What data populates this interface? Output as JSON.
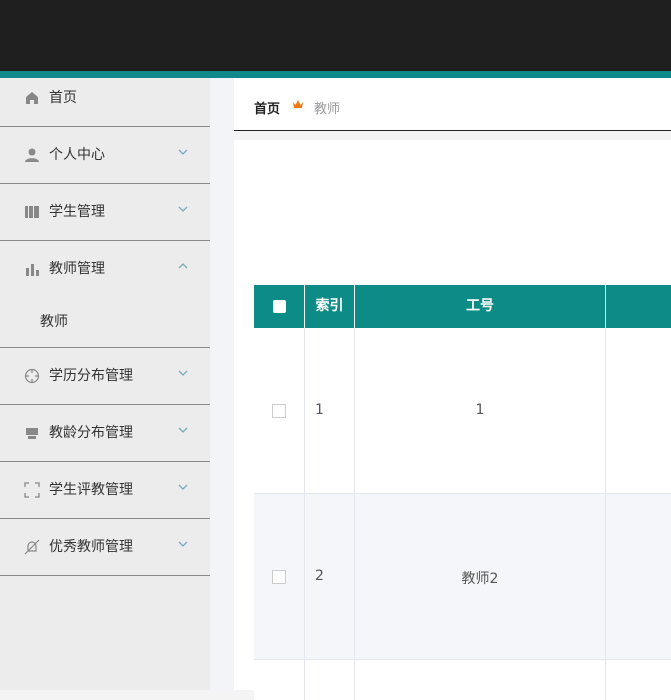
{
  "sidebar": {
    "items": [
      {
        "label": "首页",
        "icon": "home-icon"
      },
      {
        "label": "个人中心",
        "icon": "user-icon"
      },
      {
        "label": "学生管理",
        "icon": "book-icon"
      },
      {
        "label": "教师管理",
        "icon": "bar-chart-icon",
        "expanded": true,
        "sub": [
          "教师"
        ]
      },
      {
        "label": "学历分布管理",
        "icon": "crosshair-icon"
      },
      {
        "label": "教龄分布管理",
        "icon": "printer-icon"
      },
      {
        "label": "学生评教管理",
        "icon": "scan-icon"
      },
      {
        "label": "优秀教师管理",
        "icon": "bell-off-icon"
      }
    ]
  },
  "breadcrumb": {
    "home": "首页",
    "current": "教师"
  },
  "table": {
    "headers": [
      "索引",
      "工号"
    ],
    "rows": [
      {
        "index": "1",
        "id": "1"
      },
      {
        "index": "2",
        "id": "教师2"
      }
    ]
  },
  "colors": {
    "accent": "#0e8a8a",
    "header_bg": "#0d8c87",
    "topbar": "#1f1f1f"
  }
}
